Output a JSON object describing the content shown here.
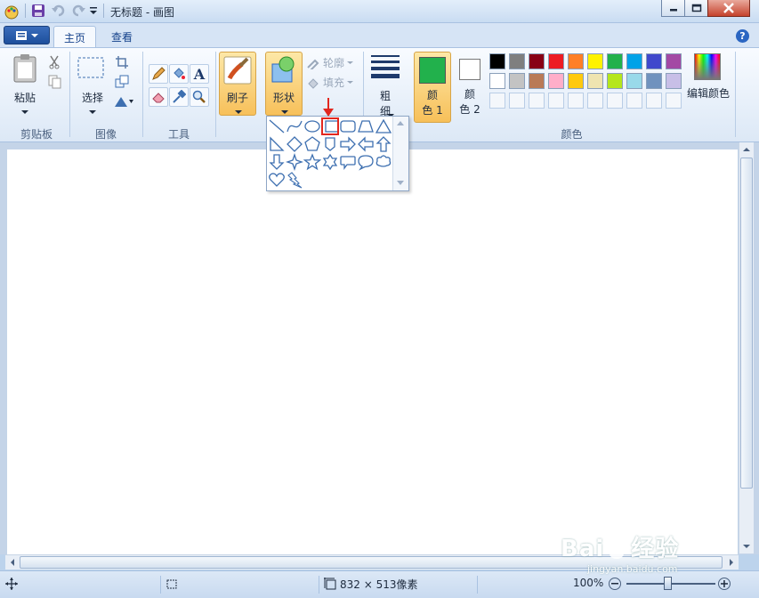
{
  "window": {
    "title": "无标题 - 画图",
    "controls": {
      "minimize": "minimize",
      "maximize": "maximize",
      "close": "close"
    }
  },
  "tabs": [
    {
      "label": "主页",
      "active": true
    },
    {
      "label": "查看",
      "active": false
    }
  ],
  "ribbon": {
    "clipboard": {
      "group_label": "剪贴板",
      "paste_label": "粘贴"
    },
    "image": {
      "group_label": "图像",
      "select_label": "选择"
    },
    "tools": {
      "group_label": "工具"
    },
    "brushes": {
      "label": "刷子"
    },
    "shapes": {
      "label": "形状",
      "outline_label": "轮廓",
      "fill_label": "填充"
    },
    "size": {
      "label_line1": "粗",
      "label_line2": "细"
    },
    "colors": {
      "group_label": "颜色",
      "color1_line1": "颜",
      "color1_line2": "色 1",
      "color2_line1": "颜",
      "color2_line2": "色 2",
      "color1_value": "#22b14c",
      "color2_value": "#ffffff",
      "edit_label": "编辑颜色",
      "palette_row1": [
        "#000000",
        "#7f7f7f",
        "#880015",
        "#ed1c24",
        "#ff7f27",
        "#fff200",
        "#22b14c",
        "#00a2e8",
        "#3f48cc",
        "#a349a4"
      ],
      "palette_row2": [
        "#ffffff",
        "#c3c3c3",
        "#b97a57",
        "#ffaec9",
        "#ffc90e",
        "#efe4b0",
        "#b5e61d",
        "#99d9ea",
        "#7092be",
        "#c8bfe7"
      ]
    }
  },
  "shapes_popup": {
    "items": [
      "line",
      "curve",
      "oval",
      "rectangle",
      "rounded-rectangle",
      "polygon",
      "triangle",
      "right-triangle",
      "diamond",
      "pentagon",
      "hexagon",
      "right-arrow",
      "left-arrow",
      "up-arrow",
      "down-arrow",
      "four-point-star",
      "five-point-star",
      "six-point-star",
      "rounded-callout",
      "oval-callout",
      "cloud-callout",
      "heart",
      "lightning"
    ],
    "selected": "rectangle"
  },
  "status": {
    "canvas_size": "832 × 513像素",
    "zoom": "100%"
  },
  "watermark": {
    "brand": "Bai",
    "brand2": "经验",
    "url": "jingyan.baidu.com"
  }
}
